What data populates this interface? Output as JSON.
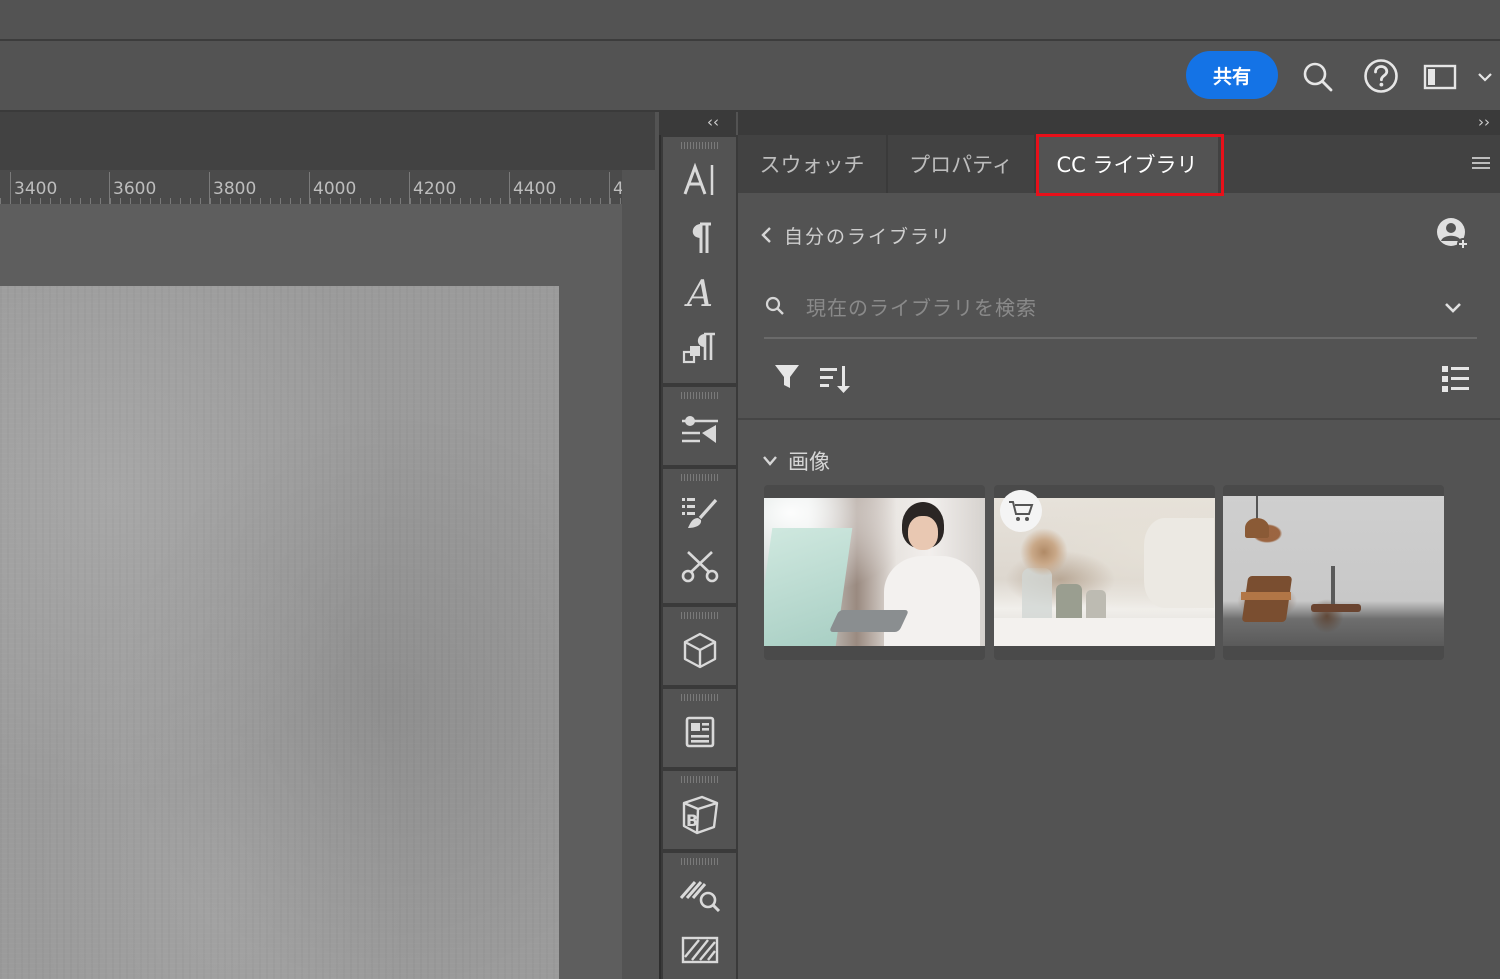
{
  "header": {
    "share_label": "共有",
    "icons": [
      "search-icon",
      "help-icon",
      "workspace-icon",
      "chevron-down-icon"
    ]
  },
  "ruler": {
    "ticks": [
      "3400",
      "3600",
      "3800",
      "4000",
      "4200",
      "4400",
      "4"
    ]
  },
  "dock": {
    "collapse_glyph": "‹‹",
    "icons": [
      "character-icon",
      "paragraph-icon",
      "glyphs-icon",
      "paragraph-styles-icon",
      "properties-sliders-icon",
      "brush-list-icon",
      "tools-scissors-icon",
      "3d-cube-icon",
      "layout-icon",
      "3d-b-cube-icon",
      "pattern-search-icon",
      "pattern-icon"
    ]
  },
  "panel": {
    "expand_glyph": "››",
    "tabs": [
      {
        "label": "スウォッチ"
      },
      {
        "label": "プロパティ"
      },
      {
        "label": "CC ライブラリ"
      }
    ],
    "active_tab": "CC ライブラリ",
    "highlight_color": "#e8101a",
    "back_label": "自分のライブラリ",
    "search_placeholder": "現在のライブラリを検索",
    "search_value": "",
    "section_label": "画像",
    "thumbnails": [
      {
        "name": "girl-laptop-image",
        "licensed": true
      },
      {
        "name": "dried-flowers-image",
        "licensed": false
      },
      {
        "name": "interior-chair-image",
        "licensed": true
      }
    ]
  },
  "colors": {
    "accent": "#1473e6",
    "panel_bg": "#535353",
    "dark_bar": "#3a3a3a"
  }
}
